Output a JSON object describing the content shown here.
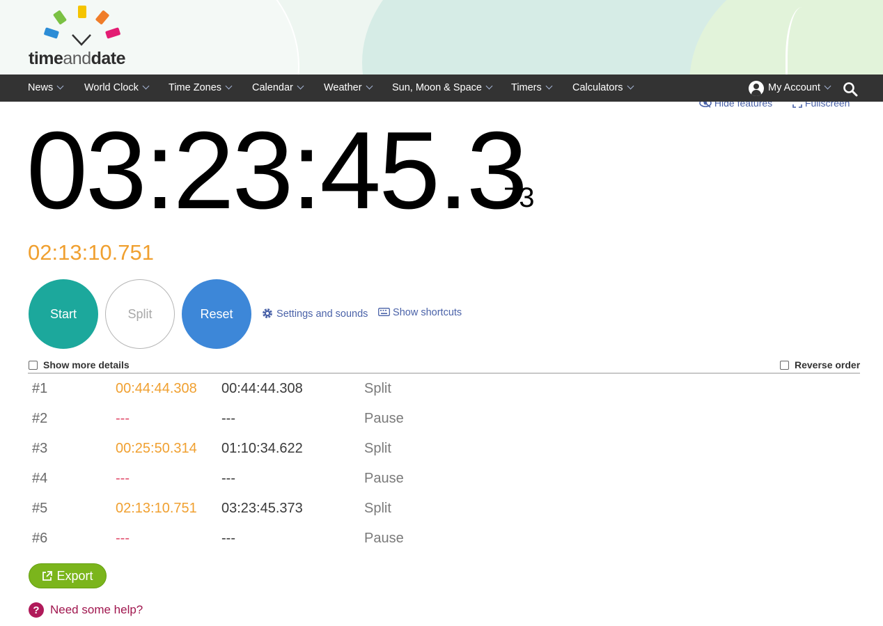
{
  "brand": {
    "logo_part1": "time",
    "logo_part2": "and",
    "logo_part3": "date"
  },
  "nav": {
    "items": [
      {
        "label": "News"
      },
      {
        "label": "World Clock"
      },
      {
        "label": "Time Zones"
      },
      {
        "label": "Calendar"
      },
      {
        "label": "Weather"
      },
      {
        "label": "Sun, Moon & Space"
      },
      {
        "label": "Timers"
      },
      {
        "label": "Calculators"
      }
    ],
    "account_label": "My Account",
    "search_icon": "search-icon",
    "account_icon": "user-circle-icon"
  },
  "tools": {
    "hide_features": "Hide features",
    "fullscreen": "Fullscreen"
  },
  "stopwatch": {
    "time_main": "03:23:45.3",
    "time_ms": "73",
    "current_lap": "02:13:10.751"
  },
  "buttons": {
    "start": "Start",
    "split": "Split",
    "reset": "Reset"
  },
  "links": {
    "settings": "Settings and sounds",
    "shortcuts": "Show shortcuts"
  },
  "options": {
    "show_more": "Show more details",
    "reverse": "Reverse order"
  },
  "laps": [
    {
      "num": "#1",
      "lap": "00:44:44.308",
      "total": "00:44:44.308",
      "type": "Split"
    },
    {
      "num": "#2",
      "lap": "---",
      "total": "---",
      "type": "Pause"
    },
    {
      "num": "#3",
      "lap": "00:25:50.314",
      "total": "01:10:34.622",
      "type": "Split"
    },
    {
      "num": "#4",
      "lap": "---",
      "total": "---",
      "type": "Pause"
    },
    {
      "num": "#5",
      "lap": "02:13:10.751",
      "total": "03:23:45.373",
      "type": "Split"
    },
    {
      "num": "#6",
      "lap": "---",
      "total": "---",
      "type": "Pause"
    }
  ],
  "export_label": "Export",
  "help_label": "Need some help?",
  "colors": {
    "nav_bg": "#333333",
    "start": "#1ca89c",
    "reset": "#3d87d8",
    "export": "#7bb51c",
    "lap_time": "#f0a030",
    "pause_dash": "#e04b6a",
    "help": "#a0164e",
    "link": "#4a62a8"
  }
}
